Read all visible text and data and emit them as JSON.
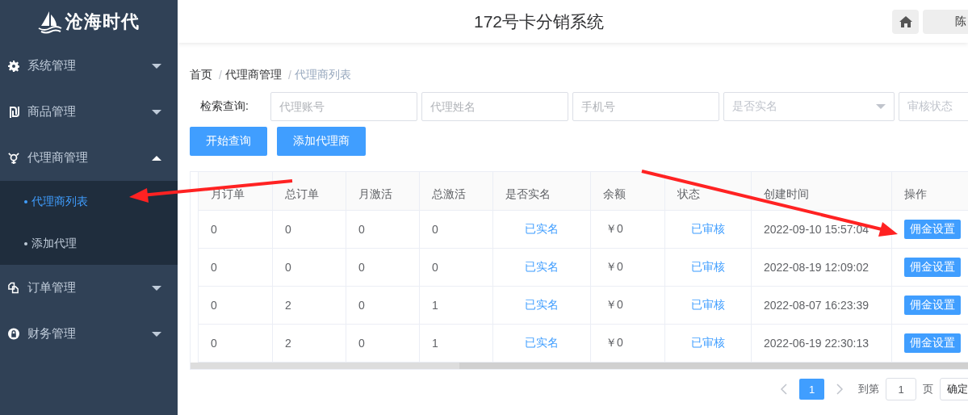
{
  "sidebar": {
    "logo": "沧海时代",
    "menu": [
      {
        "label": "系统管理",
        "expanded": false
      },
      {
        "label": "商品管理",
        "expanded": false
      },
      {
        "label": "代理商管理",
        "expanded": true,
        "children": [
          {
            "label": "代理商列表",
            "selected": true
          },
          {
            "label": "添加代理",
            "selected": false
          }
        ]
      },
      {
        "label": "订单管理",
        "expanded": false
      },
      {
        "label": "财务管理",
        "expanded": false
      }
    ]
  },
  "header": {
    "title": "172号卡分销系统",
    "user": "陈"
  },
  "breadcrumb": {
    "separator": "/",
    "items": [
      "首页",
      "代理商管理",
      "代理商列表"
    ]
  },
  "search": {
    "label": "检索查询:",
    "fields": [
      {
        "kind": "input",
        "placeholder": "代理账号"
      },
      {
        "kind": "input",
        "placeholder": "代理姓名"
      },
      {
        "kind": "input",
        "placeholder": "手机号"
      },
      {
        "kind": "select",
        "placeholder": "是否实名"
      },
      {
        "kind": "select",
        "placeholder": "审核状态"
      }
    ],
    "buttons": [
      "开始查询",
      "添加代理商"
    ]
  },
  "table": {
    "columns": [
      "月订单",
      "总订单",
      "月激活",
      "总激活",
      "是否实名",
      "余额",
      "状态",
      "创建时间",
      "操作"
    ],
    "rows": [
      {
        "cells": [
          "0",
          "0",
          "0",
          "0",
          "已实名",
          "￥0",
          "已审核",
          "2022-09-10 15:57:04"
        ],
        "action": "佣金设置"
      },
      {
        "cells": [
          "0",
          "0",
          "0",
          "0",
          "已实名",
          "￥0",
          "已审核",
          "2022-08-19 12:09:02"
        ],
        "action": "佣金设置"
      },
      {
        "cells": [
          "0",
          "2",
          "0",
          "1",
          "已实名",
          "￥0",
          "已审核",
          "2022-08-07 16:23:39"
        ],
        "action": "佣金设置"
      },
      {
        "cells": [
          "0",
          "2",
          "0",
          "1",
          "已实名",
          "￥0",
          "已审核",
          "2022-06-19 22:30:13"
        ],
        "action": "佣金设置"
      }
    ]
  },
  "pagination": {
    "pages": [
      {
        "label": "1",
        "selected": true
      }
    ],
    "goto_label": "到第",
    "page_value": "1",
    "page_unit": "页",
    "confirm": "确定"
  }
}
